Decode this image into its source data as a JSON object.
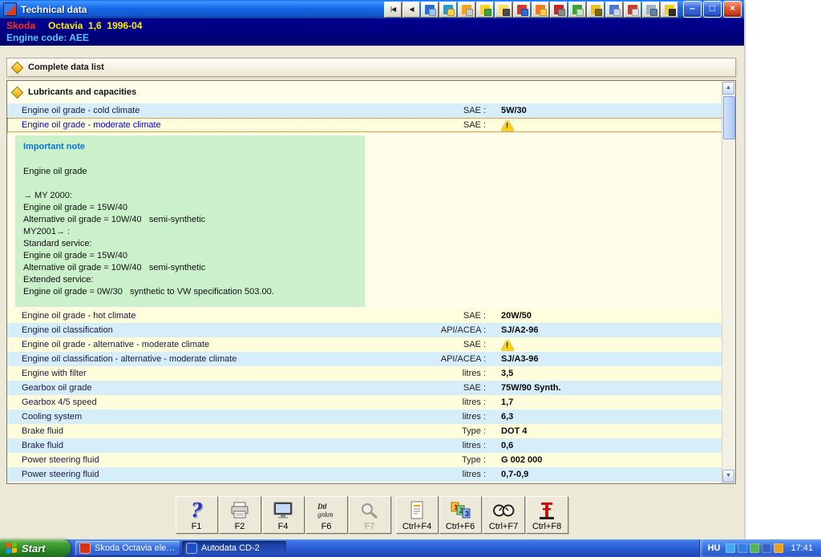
{
  "window": {
    "title": "Technical data",
    "toolbar": [
      {
        "name": "nav-first-icon",
        "glyph": "|◀"
      },
      {
        "name": "nav-prev-icon",
        "glyph": "◀"
      },
      {
        "name": "window-icon",
        "c1": "#2e6bd6",
        "c2": "#9cc4f5"
      },
      {
        "name": "contents-icon",
        "c1": "#1f9fd0",
        "c2": "#ffd24d"
      },
      {
        "name": "gears-icon",
        "c1": "#f2a51e",
        "c2": "#c8c8c8"
      },
      {
        "name": "service-schedule-icon",
        "c1": "#ffd21e",
        "c2": "#3aa53a"
      },
      {
        "name": "data-list-icon",
        "c1": "#ffe066",
        "c2": "#4a4a4a"
      },
      {
        "name": "repair-times-icon",
        "c1": "#d23b2a",
        "c2": "#2e6bd6"
      },
      {
        "name": "diagnostics-icon",
        "c1": "#f47b20",
        "c2": "#ffd24d"
      },
      {
        "name": "tools-icon",
        "c1": "#cc2222",
        "c2": "#8a8a8a"
      },
      {
        "name": "monitor-icon",
        "c1": "#3aa53a",
        "c2": "#bfe6bf"
      },
      {
        "name": "key-icon",
        "c1": "#e8c31e",
        "c2": "#7a6a10"
      },
      {
        "name": "settings-gear-icon",
        "c1": "#4a78d0",
        "c2": "#c8d8f0"
      },
      {
        "name": "wiring-icon",
        "c1": "#d23b2a",
        "c2": "#e0e0e0"
      },
      {
        "name": "globe-icon",
        "c1": "#9fb2c4",
        "c2": "#5f82a6"
      },
      {
        "name": "car-icon",
        "c1": "#e8d21e",
        "c2": "#303030"
      }
    ],
    "controls": [
      {
        "name": "minimize-button",
        "glyph": "–"
      },
      {
        "name": "restore-button",
        "glyph": "□"
      },
      {
        "name": "close-button",
        "glyph": "×"
      }
    ]
  },
  "vehicle": {
    "make": "Skoda",
    "model": "Octavia  1,6  1996-04",
    "engine_code": "Engine code: AEE"
  },
  "complete_bar": {
    "label": "Complete data list"
  },
  "section": {
    "title": "Lubricants and capacities"
  },
  "table": {
    "rows_top": [
      {
        "label": "Engine oil grade - cold climate",
        "key": "SAE :",
        "value": "5W/30"
      },
      {
        "label": "Engine oil grade - moderate climate",
        "key": "SAE :",
        "warning": true,
        "selected": true
      }
    ],
    "rows_bottom": [
      {
        "label": "Engine oil grade - hot climate",
        "key": "SAE :",
        "value": "20W/50"
      },
      {
        "label": "Engine oil classification",
        "key": "API/ACEA :",
        "value": "SJ/A2-96"
      },
      {
        "label": "Engine oil grade - alternative - moderate climate",
        "key": "SAE :",
        "warning": true
      },
      {
        "label": "Engine oil classification - alternative - moderate climate",
        "key": "API/ACEA :",
        "value": "SJ/A3-96"
      },
      {
        "label": "Engine with filter",
        "key": "litres :",
        "value": "3,5"
      },
      {
        "label": "Gearbox oil grade",
        "key": "SAE :",
        "value": "75W/90 Synth."
      },
      {
        "label": "Gearbox 4/5 speed",
        "key": "litres :",
        "value": "1,7"
      },
      {
        "label": "Cooling system",
        "key": "litres :",
        "value": "6,3"
      },
      {
        "label": "Brake fluid",
        "key": "Type :",
        "value": "DOT 4"
      },
      {
        "label": "Brake fluid",
        "key": "litres :",
        "value": "0,6"
      },
      {
        "label": "Power steering fluid",
        "key": "Type :",
        "value": "G 002 000"
      },
      {
        "label": "Power steering fluid",
        "key": "litres :",
        "value": "0,7-0,9"
      }
    ]
  },
  "note": {
    "title": "Important note",
    "lines": [
      "Engine oil grade",
      "",
      "→ MY 2000:",
      "Engine oil grade = 15W/40",
      "Alternative oil grade = 10W/40   semi-synthetic",
      "MY2001→ :",
      "Standard service:",
      "Engine oil grade = 15W/40",
      "Alternative oil grade = 10W/40   semi-synthetic",
      "Extended service:",
      "Engine oil grade = 0W/30   synthetic to VW specification 503.00."
    ]
  },
  "scrollbar": {
    "up": "▲",
    "down": "▼"
  },
  "actions": [
    {
      "name": "help-button",
      "icon": "help",
      "key": "F1"
    },
    {
      "name": "print-button",
      "icon": "printer",
      "key": "F2"
    },
    {
      "name": "screen-button",
      "icon": "monitor",
      "key": "F4"
    },
    {
      "name": "notes-button",
      "icon": "text-note",
      "key": "F6"
    },
    {
      "name": "zoom-button",
      "icon": "magnifier",
      "key": "F7",
      "disabled": true
    },
    {
      "name": "data-list-button",
      "icon": "document",
      "key": "Ctrl+F4",
      "group": true
    },
    {
      "name": "values-button",
      "icon": "numbers",
      "key": "Ctrl+F6"
    },
    {
      "name": "gauges-button",
      "icon": "gauges",
      "key": "Ctrl+F7"
    },
    {
      "name": "lift-button",
      "icon": "jack",
      "key": "Ctrl+F8"
    }
  ],
  "taskbar": {
    "start_label": "Start",
    "tasks": [
      {
        "name": "taskbar-item-skoda",
        "label": "Skoda Octavia elektr...",
        "icon_color": "#d63415",
        "active": false
      },
      {
        "name": "taskbar-item-autodata",
        "label": "Autodata CD-2",
        "icon_color": "#1d4fc4",
        "active": true
      }
    ],
    "tray": {
      "language": "HU",
      "icons": [
        {
          "name": "tray-volume-icon",
          "color": "#3fa9f5"
        },
        {
          "name": "tray-network-icon",
          "color": "#2e7de0"
        },
        {
          "name": "tray-antivirus-icon",
          "color": "#54b454"
        },
        {
          "name": "tray-display-icon",
          "color": "#3560c0"
        },
        {
          "name": "tray-update-icon",
          "color": "#e8a020"
        }
      ],
      "time": "17:41"
    }
  },
  "colors": {
    "titlebar_blue": "#1668e8",
    "navy_bar": "#000080",
    "panel_yellow": "#ffffe9",
    "row_blue": "#d6eefa",
    "note_green": "#cbf1cb",
    "warning_yellow": "#ffd400"
  }
}
